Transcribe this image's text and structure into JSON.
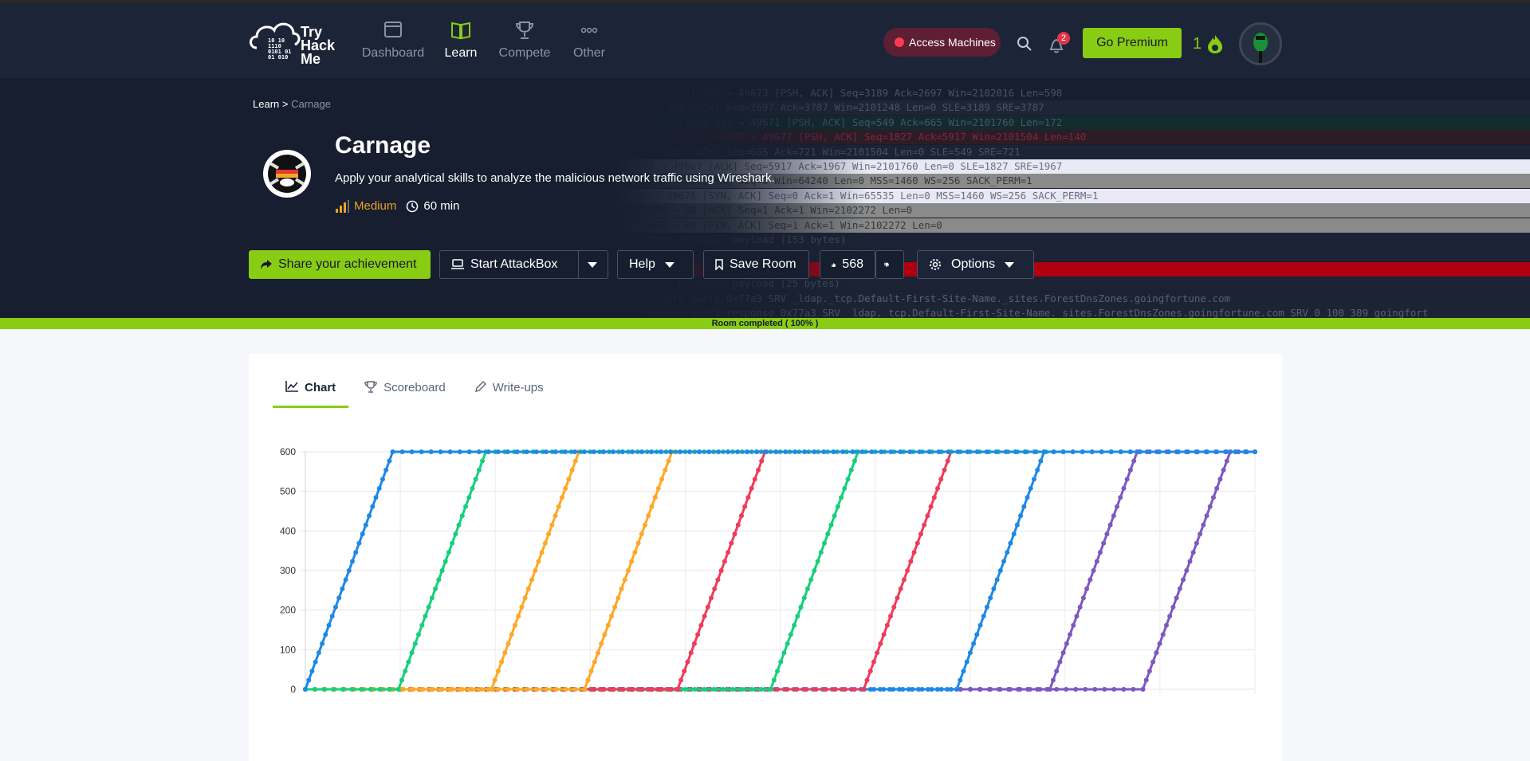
{
  "nav": {
    "logo_text": [
      "Try",
      "Hack",
      "Me"
    ],
    "logo_binary": [
      "10 10",
      "1110",
      "0101 01",
      "01 010"
    ],
    "items": [
      {
        "label": "Dashboard",
        "icon": "dashboard-icon"
      },
      {
        "label": "Learn",
        "icon": "book-icon"
      },
      {
        "label": "Compete",
        "icon": "trophy-icon"
      },
      {
        "label": "Other",
        "icon": "more-icon"
      }
    ],
    "access_label": "Access Machines",
    "notification_count": "2",
    "premium_label": "Go Premium",
    "streak": "1"
  },
  "hero": {
    "breadcrumb_root": "Learn",
    "breadcrumb_sep": ">",
    "breadcrumb_current": "Carnage",
    "title": "Carnage",
    "description": "Apply your analytical skills to analyze the malicious network traffic using Wireshark.",
    "difficulty": "Medium",
    "duration": "60 min",
    "packet_lines": [
      "plication] 389 → 49673 [PSH, ACK] Seq=3189 Ack=2697 Win=2102016 Len=598",
      "73 → 389 [ACK] Seq=2697 Ack=3787 Win=2101248 Len=0 SLE=3189 SRE=3787",
      "ransmission] 135 → 49671 [PSH, ACK] Seq=549 Ack=665 Win=2101760 Len=172",
      "ransmission] 49667 → 49677 [PSH, ACK] Seq=1827 Ack=5917 Win=2101504 Len=140",
      "71 → 135 [ACK] Seq=665 Ack=721 Win=2101504 Len=0 SLE=549 SRE=721",
      "677 → 49667 [ACK] Seq=5917 Ack=1967 Win=2101760 Len=0 SLE=1827 SRE=1967",
      "49678 → 88 [SYN] Seq=0 Win=64240 Len=0 MSS=1460 WS=256 SACK_PERM=1",
      "88 → 49678 [SYN, ACK] Seq=0 Ack=1 Win=65535 Len=0 MSS=1460 WS=256 SACK_PERM=1",
      "49678 → 88 [ACK] Seq=1 Ack=1 Win=2102272 Len=0",
      "49678 → 88 [FIN, ACK] Seq=1 Ack=1 Win=2102272 Len=0",
      "DCERPC Privacy: payload (153 bytes)",
      "",
      "",
      "DCERPC Privacy: payload (25 bytes)",
      "Standard query 0x77a3 SRV _ldap._tcp.Default-First-Site-Name._sites.ForestDnsZones.goingfortune.com",
      "Standard query response 0x77a3 SRV _ldap._tcp.Default-First-Site-Name._sites.ForestDnsZones.goingfortune.com SRV 0 100 389 goingfort"
    ]
  },
  "actions": {
    "share": "Share your achievement",
    "attackbox": "Start AttackBox",
    "help": "Help",
    "save": "Save Room",
    "likes": "568",
    "options": "Options"
  },
  "progress": {
    "label": "Room completed ( 100% )",
    "value": 100
  },
  "tabs": [
    {
      "label": "Chart",
      "icon": "chart-icon",
      "active": true
    },
    {
      "label": "Scoreboard",
      "icon": "trophy-icon",
      "active": false
    },
    {
      "label": "Write-ups",
      "icon": "pencil-icon",
      "active": false
    }
  ],
  "chart_data": {
    "type": "line",
    "ylim": [
      0,
      600
    ],
    "yticks": [
      "0",
      "100",
      "200",
      "300",
      "400",
      "500",
      "600"
    ],
    "x_range": [
      0,
      100
    ],
    "colors": {
      "blue": "#1e88e5",
      "green": "#16d07a",
      "orange": "#ffa726",
      "red": "#ef3b5c",
      "purple": "#7e57c2"
    },
    "series": [
      {
        "color": "#1e88e5",
        "x": [
          0,
          9.2,
          100
        ],
        "y": [
          0,
          600,
          600
        ]
      },
      {
        "color": "#16d07a",
        "x": [
          0,
          9.8,
          19.0,
          78.0
        ],
        "y": [
          0,
          0,
          600,
          600
        ]
      },
      {
        "color": "#ffa726",
        "x": [
          0,
          19.6,
          28.8
        ],
        "y": [
          0,
          0,
          600
        ]
      },
      {
        "color": "#ffa726",
        "x": [
          0,
          29.4,
          38.6
        ],
        "y": [
          0,
          0,
          600
        ]
      },
      {
        "color": "#ef3b5c",
        "x": [
          0,
          39.2,
          48.4
        ],
        "y": [
          0,
          0,
          600
        ]
      },
      {
        "color": "#16d07a",
        "x": [
          0,
          49.0,
          58.2
        ],
        "y": [
          0,
          0,
          600
        ]
      },
      {
        "color": "#ef3b5c",
        "x": [
          0,
          58.8,
          68.0
        ],
        "y": [
          0,
          0,
          600
        ]
      },
      {
        "color": "#1e88e5",
        "x": [
          0,
          68.6,
          77.8,
          100
        ],
        "y": [
          0,
          0,
          600,
          600
        ]
      },
      {
        "color": "#7e57c2",
        "x": [
          69.0,
          78.4,
          87.6,
          100
        ],
        "y": [
          0,
          0,
          600,
          600
        ]
      },
      {
        "color": "#7e57c2",
        "x": [
          69.0,
          88.2,
          97.4,
          100
        ],
        "y": [
          0,
          0,
          600,
          600
        ]
      },
      {
        "color": "#1e88e5",
        "x": [
          0,
          69.0
        ],
        "y": [
          0,
          0
        ]
      }
    ]
  }
}
